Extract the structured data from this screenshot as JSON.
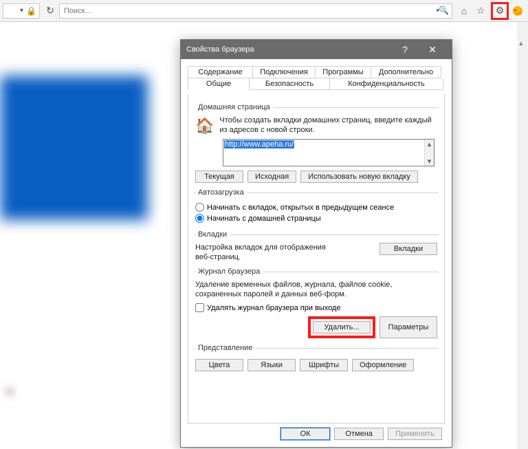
{
  "toolbar": {
    "search_placeholder": "Поиск..."
  },
  "dialog": {
    "title": "Свойства браузера",
    "tabs_row1": {
      "content": "Содержание",
      "connections": "Подключения",
      "programs": "Программы",
      "advanced": "Дополнительно"
    },
    "tabs_row2": {
      "general": "Общие",
      "security": "Безопасность",
      "privacy": "Конфиденциальность"
    },
    "home": {
      "legend": "Домашняя страница",
      "text": "Чтобы создать вкладки домашних страниц, введите каждый из адресов с новой строки.",
      "url": "http://www.apeha.ru/",
      "btn_current": "Текущая",
      "btn_default": "Исходная",
      "btn_newtab": "Использовать новую вкладку"
    },
    "startup": {
      "legend": "Автозагрузка",
      "opt1": "Начинать с вкладок, открытых в предыдущем сеансе",
      "opt2": "Начинать с домашней страницы"
    },
    "tabs": {
      "legend": "Вкладки",
      "desc": "Настройка вкладок для отображения веб-страниц.",
      "btn": "Вкладки"
    },
    "journal": {
      "legend": "Журнал браузера",
      "desc": "Удаление временных файлов, журнала, файлов cookie, сохраненных паролей и данных веб-форм.",
      "check": "Удалять журнал браузера при выходе",
      "btn_delete": "Удалить...",
      "btn_params": "Параметры"
    },
    "appearance": {
      "legend": "Представление",
      "btn_colors": "Цвета",
      "btn_lang": "Языки",
      "btn_fonts": "Шрифты",
      "btn_style": "Оформление"
    },
    "buttons": {
      "ok": "ОК",
      "cancel": "Отмена",
      "apply": "Применить"
    }
  }
}
